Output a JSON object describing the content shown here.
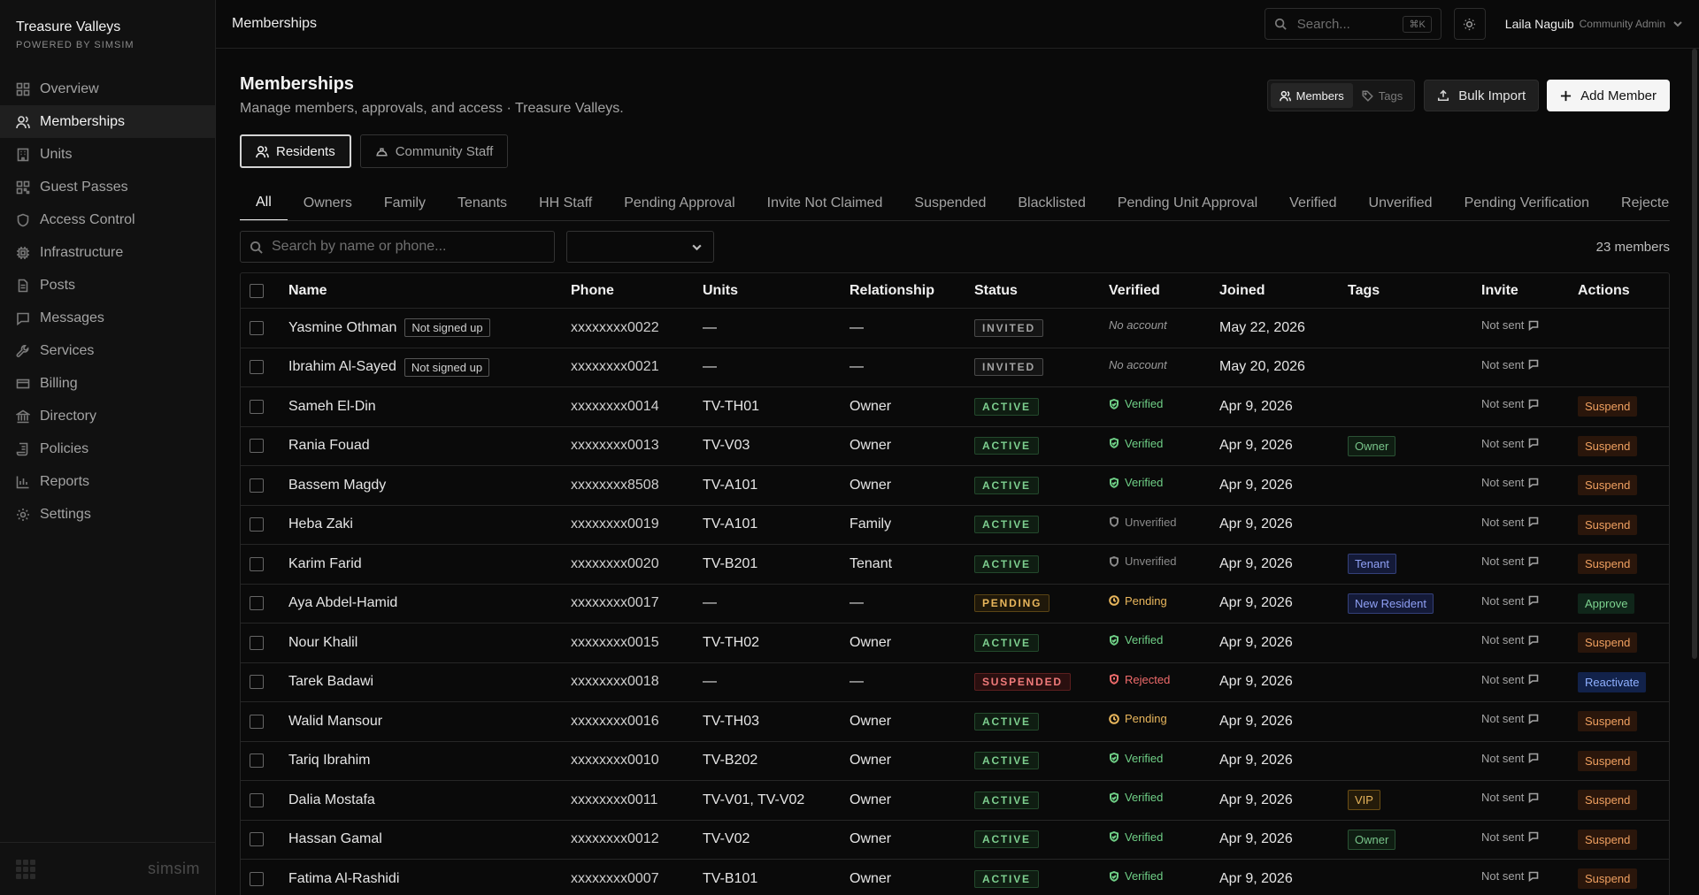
{
  "sidebar": {
    "brand": "Treasure Valleys",
    "brand_sub": "POWERED BY SIMSIM",
    "items": [
      {
        "label": "Overview"
      },
      {
        "label": "Memberships"
      },
      {
        "label": "Units"
      },
      {
        "label": "Guest Passes"
      },
      {
        "label": "Access Control"
      },
      {
        "label": "Infrastructure"
      },
      {
        "label": "Posts"
      },
      {
        "label": "Messages"
      },
      {
        "label": "Services"
      },
      {
        "label": "Billing"
      },
      {
        "label": "Directory"
      },
      {
        "label": "Policies"
      },
      {
        "label": "Reports"
      },
      {
        "label": "Settings"
      }
    ],
    "footer_logo": "simsim"
  },
  "topbar": {
    "title": "Memberships",
    "search_placeholder": "Search...",
    "search_shortcut": "⌘K",
    "user_name": "Laila Naguib",
    "user_role": "Community Admin"
  },
  "page": {
    "title": "Memberships",
    "subtitle": "Manage members, approvals, and access · Treasure Valleys.",
    "toggle_members": "Members",
    "toggle_tags": "Tags",
    "bulk_import": "Bulk Import",
    "add_member": "Add Member",
    "seg_residents": "Residents",
    "seg_staff": "Community Staff",
    "tabs": [
      "All",
      "Owners",
      "Family",
      "Tenants",
      "HH Staff",
      "Pending Approval",
      "Invite Not Claimed",
      "Suspended",
      "Blacklisted",
      "Pending Unit Approval",
      "Verified",
      "Unverified",
      "Pending Verification",
      "Rejected"
    ],
    "filter_placeholder": "Search by name or phone...",
    "member_count": "23 members"
  },
  "table": {
    "headers": {
      "name": "Name",
      "phone": "Phone",
      "units": "Units",
      "relationship": "Relationship",
      "status": "Status",
      "verified": "Verified",
      "joined": "Joined",
      "tags": "Tags",
      "invite": "Invite",
      "actions": "Actions"
    },
    "rows": [
      {
        "name": "Yasmine Othman",
        "badge": "Not signed up",
        "phone": "xxxxxxxx0022",
        "units": "—",
        "rel": "—",
        "status": "INVITED",
        "st": "invited",
        "verified": "No account",
        "vk": "none",
        "joined": "May 22, 2026",
        "tag": "",
        "tk": "",
        "invite": "Not sent",
        "action": "",
        "ak": ""
      },
      {
        "name": "Ibrahim Al-Sayed",
        "badge": "Not signed up",
        "phone": "xxxxxxxx0021",
        "units": "—",
        "rel": "—",
        "status": "INVITED",
        "st": "invited",
        "verified": "No account",
        "vk": "none",
        "joined": "May 20, 2026",
        "tag": "",
        "tk": "",
        "invite": "Not sent",
        "action": "",
        "ak": ""
      },
      {
        "name": "Sameh El-Din",
        "badge": "",
        "phone": "xxxxxxxx0014",
        "units": "TV-TH01",
        "rel": "Owner",
        "status": "ACTIVE",
        "st": "active",
        "verified": "Verified",
        "vk": "ver",
        "joined": "Apr 9, 2026",
        "tag": "",
        "tk": "",
        "invite": "Not sent",
        "action": "Suspend",
        "ak": "sus"
      },
      {
        "name": "Rania Fouad",
        "badge": "",
        "phone": "xxxxxxxx0013",
        "units": "TV-V03",
        "rel": "Owner",
        "status": "ACTIVE",
        "st": "active",
        "verified": "Verified",
        "vk": "ver",
        "joined": "Apr 9, 2026",
        "tag": "Owner",
        "tk": "owner",
        "invite": "Not sent",
        "action": "Suspend",
        "ak": "sus"
      },
      {
        "name": "Bassem Magdy",
        "badge": "",
        "phone": "xxxxxxxx8508",
        "units": "TV-A101",
        "rel": "Owner",
        "status": "ACTIVE",
        "st": "active",
        "verified": "Verified",
        "vk": "ver",
        "joined": "Apr 9, 2026",
        "tag": "",
        "tk": "",
        "invite": "Not sent",
        "action": "Suspend",
        "ak": "sus"
      },
      {
        "name": "Heba Zaki",
        "badge": "",
        "phone": "xxxxxxxx0019",
        "units": "TV-A101",
        "rel": "Family",
        "status": "ACTIVE",
        "st": "active",
        "verified": "Unverified",
        "vk": "unv",
        "joined": "Apr 9, 2026",
        "tag": "",
        "tk": "",
        "invite": "Not sent",
        "action": "Suspend",
        "ak": "sus"
      },
      {
        "name": "Karim Farid",
        "badge": "",
        "phone": "xxxxxxxx0020",
        "units": "TV-B201",
        "rel": "Tenant",
        "status": "ACTIVE",
        "st": "active",
        "verified": "Unverified",
        "vk": "unv",
        "joined": "Apr 9, 2026",
        "tag": "Tenant",
        "tk": "tenant",
        "invite": "Not sent",
        "action": "Suspend",
        "ak": "sus"
      },
      {
        "name": "Aya Abdel-Hamid",
        "badge": "",
        "phone": "xxxxxxxx0017",
        "units": "—",
        "rel": "—",
        "status": "PENDING",
        "st": "pending",
        "verified": "Pending",
        "vk": "pen",
        "joined": "Apr 9, 2026",
        "tag": "New Resident",
        "tk": "new",
        "invite": "Not sent",
        "action": "Approve",
        "ak": "app"
      },
      {
        "name": "Nour Khalil",
        "badge": "",
        "phone": "xxxxxxxx0015",
        "units": "TV-TH02",
        "rel": "Owner",
        "status": "ACTIVE",
        "st": "active",
        "verified": "Verified",
        "vk": "ver",
        "joined": "Apr 9, 2026",
        "tag": "",
        "tk": "",
        "invite": "Not sent",
        "action": "Suspend",
        "ak": "sus"
      },
      {
        "name": "Tarek Badawi",
        "badge": "",
        "phone": "xxxxxxxx0018",
        "units": "—",
        "rel": "—",
        "status": "SUSPENDED",
        "st": "suspended",
        "verified": "Rejected",
        "vk": "rej",
        "joined": "Apr 9, 2026",
        "tag": "",
        "tk": "",
        "invite": "Not sent",
        "action": "Reactivate",
        "ak": "rea"
      },
      {
        "name": "Walid Mansour",
        "badge": "",
        "phone": "xxxxxxxx0016",
        "units": "TV-TH03",
        "rel": "Owner",
        "status": "ACTIVE",
        "st": "active",
        "verified": "Pending",
        "vk": "pen",
        "joined": "Apr 9, 2026",
        "tag": "",
        "tk": "",
        "invite": "Not sent",
        "action": "Suspend",
        "ak": "sus"
      },
      {
        "name": "Tariq Ibrahim",
        "badge": "",
        "phone": "xxxxxxxx0010",
        "units": "TV-B202",
        "rel": "Owner",
        "status": "ACTIVE",
        "st": "active",
        "verified": "Verified",
        "vk": "ver",
        "joined": "Apr 9, 2026",
        "tag": "",
        "tk": "",
        "invite": "Not sent",
        "action": "Suspend",
        "ak": "sus"
      },
      {
        "name": "Dalia Mostafa",
        "badge": "",
        "phone": "xxxxxxxx0011",
        "units": "TV-V01, TV-V02",
        "rel": "Owner",
        "status": "ACTIVE",
        "st": "active",
        "verified": "Verified",
        "vk": "ver",
        "joined": "Apr 9, 2026",
        "tag": "VIP",
        "tk": "vip",
        "invite": "Not sent",
        "action": "Suspend",
        "ak": "sus"
      },
      {
        "name": "Hassan Gamal",
        "badge": "",
        "phone": "xxxxxxxx0012",
        "units": "TV-V02",
        "rel": "Owner",
        "status": "ACTIVE",
        "st": "active",
        "verified": "Verified",
        "vk": "ver",
        "joined": "Apr 9, 2026",
        "tag": "Owner",
        "tk": "owner",
        "invite": "Not sent",
        "action": "Suspend",
        "ak": "sus"
      },
      {
        "name": "Fatima Al-Rashidi",
        "badge": "",
        "phone": "xxxxxxxx0007",
        "units": "TV-B101",
        "rel": "Owner",
        "status": "ACTIVE",
        "st": "active",
        "verified": "Verified",
        "vk": "ver",
        "joined": "Apr 9, 2026",
        "tag": "",
        "tk": "",
        "invite": "Not sent",
        "action": "Suspend",
        "ak": "sus"
      }
    ]
  }
}
